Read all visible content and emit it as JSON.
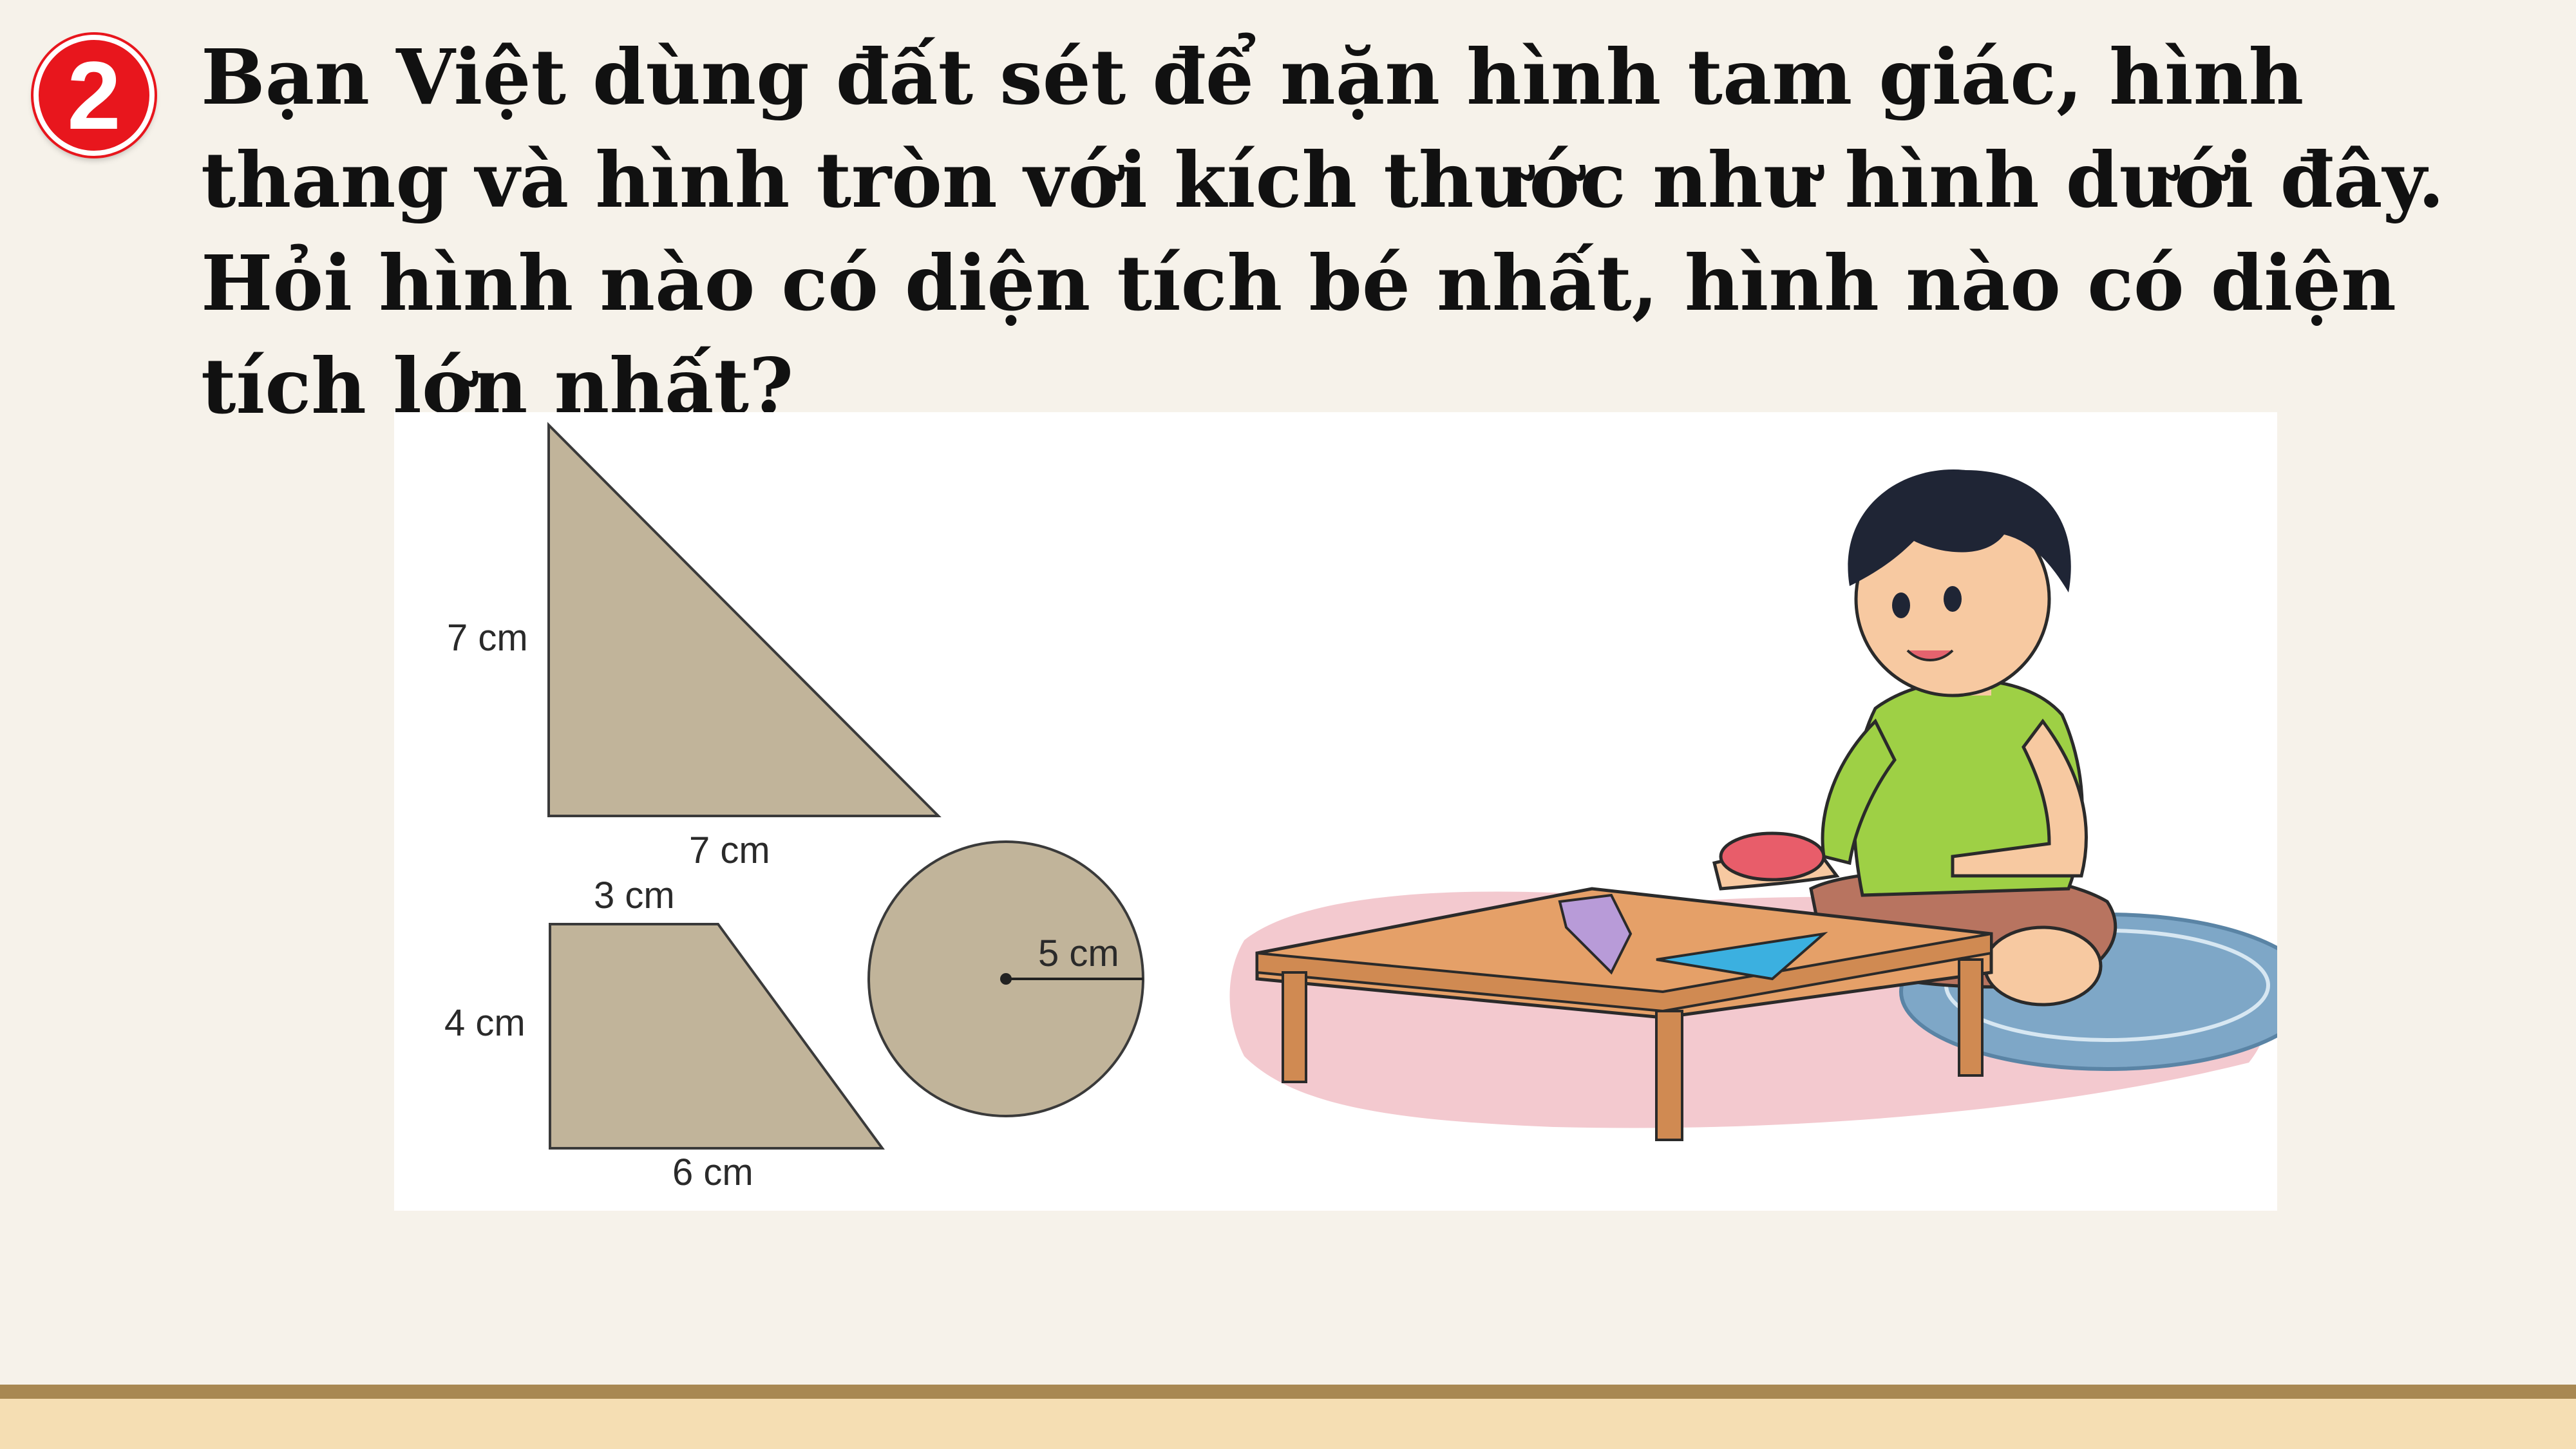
{
  "exercise": {
    "number": "2",
    "question": "Bạn Việt dùng đất sét để nặn hình tam giác, hình thang và hình tròn với kích thước như hình dưới đây. Hỏi hình nào có diện tích bé nhất, hình nào có diện tích lớn nhất?"
  },
  "figure": {
    "triangle": {
      "height_label": "7 cm",
      "base_label": "7 cm"
    },
    "trapezoid": {
      "top_label": "3 cm",
      "height_label": "4 cm",
      "bottom_label": "6 cm"
    },
    "circle": {
      "radius_label": "5 cm"
    }
  },
  "colors": {
    "badge": "#e8161d",
    "clay_shape": "#c1b49a",
    "footer_line": "#a88852",
    "footer_band": "#f5deb3"
  }
}
